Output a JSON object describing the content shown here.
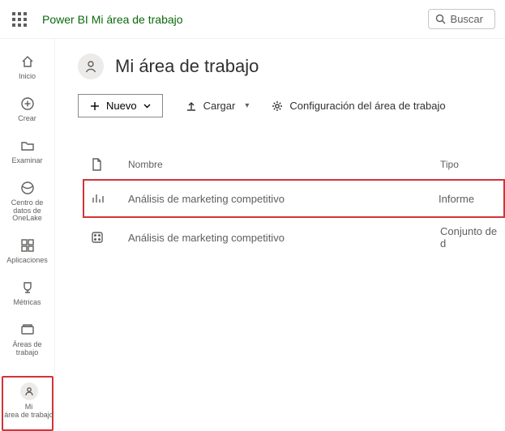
{
  "header": {
    "brand": "Power BI",
    "breadcrumb": "Mi área de trabajo",
    "search_label": "Buscar"
  },
  "rail": {
    "items": [
      {
        "label": "Inicio"
      },
      {
        "label": "Crear"
      },
      {
        "label": "Examinar"
      },
      {
        "label": "Centro de datos de OneLake"
      },
      {
        "label": "Aplicaciones"
      },
      {
        "label": "Métricas"
      },
      {
        "label": "Áreas de trabajo"
      }
    ],
    "current": {
      "label_line1": "Mi",
      "label_line2": "área de trabajo"
    }
  },
  "workspace": {
    "title": "Mi área de trabajo",
    "toolbar": {
      "new_label": "Nuevo",
      "upload_label": "Cargar",
      "settings_label": "Configuración del área de trabajo"
    },
    "columns": {
      "name": "Nombre",
      "type": "Tipo"
    },
    "items": [
      {
        "name": "Análisis de marketing competitivo",
        "type": "Informe",
        "kind": "report"
      },
      {
        "name": "Análisis de marketing competitivo",
        "type": "Conjunto de d",
        "kind": "dataset"
      }
    ]
  }
}
